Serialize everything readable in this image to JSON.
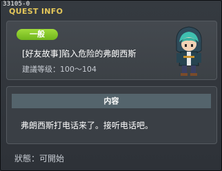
{
  "window": {
    "quest_id": "33105-0",
    "title": "QUEST INFO"
  },
  "quest": {
    "badge": "一般",
    "name": "[好友故事]陷入危险的弗朗西斯",
    "level": "建議等级：100～104"
  },
  "content": {
    "header": "内容",
    "text": "弗朗西斯打电话来了。接听电话吧。"
  },
  "status": "狀態：可開始",
  "colors": {
    "title": "#e4c75a",
    "badge": "#8acb2e",
    "panel_header": "#54646c"
  }
}
